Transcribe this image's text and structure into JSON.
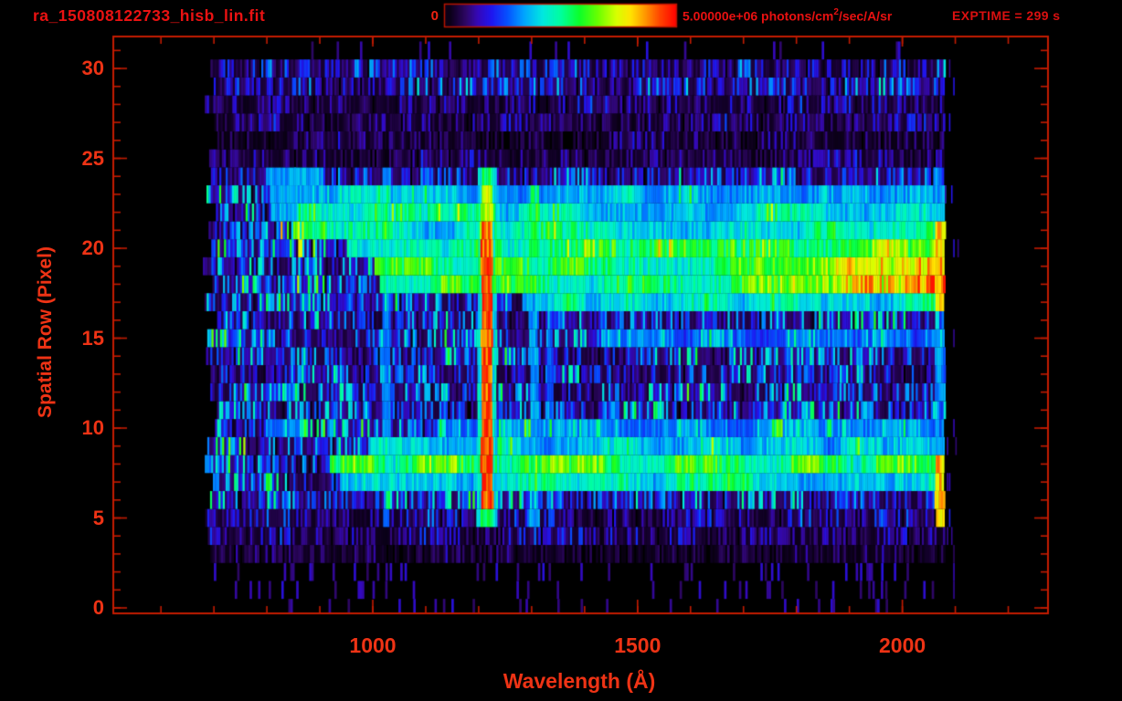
{
  "chart_data": {
    "type": "heatmap",
    "title": "ra_150808122733_hisb_lin.fit",
    "xlabel": "Wavelength (Å)",
    "ylabel": "Spatial Row (Pixel)",
    "exptime_label": "EXPTIME = 299 s",
    "exptime_s": 299,
    "xlim": [
      510,
      2275
    ],
    "ylim": [
      -0.3,
      32
    ],
    "x_ticks": [
      1000,
      1500,
      2000
    ],
    "x_minor_step": 100,
    "x_minor_range": [
      600,
      2200
    ],
    "y_ticks": [
      0,
      5,
      10,
      15,
      20,
      25,
      30
    ],
    "y_minor_step": 1,
    "grid": false,
    "legend": "colorbar-top",
    "colorbar": {
      "min": 0,
      "max": 5000000,
      "min_label": "0",
      "max_label_prefix": "5.00000e+06 photons/cm",
      "max_label_sup": "2",
      "max_label_suffix": "/sec/A/sr",
      "units": "photons/cm^2/sec/A/sr",
      "palette": "rainbow"
    },
    "data_extent": {
      "wavelength": [
        685,
        2078
      ],
      "rows": [
        0,
        31
      ]
    },
    "palette_stops": [
      [
        0.0,
        "#000000"
      ],
      [
        0.04,
        "#15002e"
      ],
      [
        0.09,
        "#2e0766"
      ],
      [
        0.14,
        "#3508b8"
      ],
      [
        0.2,
        "#1f16f0"
      ],
      [
        0.27,
        "#0553ff"
      ],
      [
        0.34,
        "#00a4ff"
      ],
      [
        0.42,
        "#00e8e0"
      ],
      [
        0.5,
        "#00ff9d"
      ],
      [
        0.58,
        "#0cff2a"
      ],
      [
        0.66,
        "#6aff00"
      ],
      [
        0.74,
        "#d8ff00"
      ],
      [
        0.8,
        "#ffe400"
      ],
      [
        0.87,
        "#ff9000"
      ],
      [
        0.93,
        "#ff4200"
      ],
      [
        1.0,
        "#ff0000"
      ]
    ],
    "rows": [
      {
        "r": 0,
        "bg": 0.015
      },
      {
        "r": 1,
        "bg": 0.02
      },
      {
        "r": 2,
        "bg": 0.025
      },
      {
        "r": 3,
        "bg": 0.06
      },
      {
        "r": 4,
        "bg": 0.1
      },
      {
        "r": 5,
        "bg": 0.13
      },
      {
        "r": 6,
        "bg": 0.21
      },
      {
        "r": 7,
        "bg": 0.22,
        "band": 0.4,
        "from": 935
      },
      {
        "r": 8,
        "bg": 0.22,
        "band": 0.52,
        "from": 915
      },
      {
        "r": 9,
        "bg": 0.24,
        "band": 0.36,
        "from": 990
      },
      {
        "r": 10,
        "bg": 0.26,
        "band": 0.3,
        "from": 1120
      },
      {
        "r": 11,
        "bg": 0.23
      },
      {
        "r": 12,
        "bg": 0.22
      },
      {
        "r": 13,
        "bg": 0.19
      },
      {
        "r": 14,
        "bg": 0.21
      },
      {
        "r": 15,
        "bg": 0.23,
        "band": 0.27,
        "from": 1430
      },
      {
        "r": 16,
        "bg": 0.2
      },
      {
        "r": 17,
        "bg": 0.24,
        "band": 0.42,
        "from": 1280
      },
      {
        "r": 18,
        "bg": 0.28,
        "band": 0.5,
        "from": 1010,
        "ramp": 0.42,
        "ramp_from": 1640
      },
      {
        "r": 19,
        "bg": 0.28,
        "band": 0.52,
        "from": 1000,
        "ramp": 0.36,
        "ramp_from": 1620
      },
      {
        "r": 20,
        "bg": 0.28,
        "band": 0.46,
        "from": 950,
        "ramp": 0.22,
        "ramp_from": 1700
      },
      {
        "r": 21,
        "bg": 0.28,
        "band": 0.43,
        "from": 890,
        "ramp": 0.1,
        "ramp_from": 1750
      },
      {
        "r": 22,
        "bg": 0.26,
        "band": 0.4,
        "from": 855
      },
      {
        "r": 23,
        "bg": 0.24,
        "band": 0.34,
        "from": 820
      },
      {
        "r": 24,
        "bg": 0.22
      },
      {
        "r": 25,
        "bg": 0.08
      },
      {
        "r": 26,
        "bg": 0.07
      },
      {
        "r": 27,
        "bg": 0.09
      },
      {
        "r": 28,
        "bg": 0.11
      },
      {
        "r": 29,
        "bg": 0.17
      },
      {
        "r": 30,
        "bg": 0.16
      },
      {
        "r": 31,
        "bg": 0.01
      }
    ],
    "emission_lines": [
      {
        "wl": 1025.7,
        "half_width": 7,
        "rows": [
          4.5,
          24.3
        ],
        "boost": 0.3,
        "extra_rows": [
          19,
          23.5
        ],
        "extra_boost": 0.48
      },
      {
        "wl": 1304,
        "half_width": 8,
        "rows": [
          4.5,
          23.5
        ],
        "boost": 0.34,
        "extra_rows": [
          19,
          23.5
        ],
        "extra_boost": 0.5
      },
      {
        "wl": 1335,
        "half_width": 5,
        "rows": [
          4.5,
          23.5
        ],
        "boost": 0.26
      }
    ],
    "lyman_alpha": {
      "wl": 1215.7,
      "core_half": 11,
      "halo_half": 19,
      "rows": [
        4.6,
        24.4
      ],
      "halo_boost": 0.42,
      "core_levels": [
        {
          "upto": 5.5,
          "v": 0.55
        },
        {
          "upto": 21.5,
          "v": 0.93
        },
        {
          "upto": 23.5,
          "v": 0.72
        },
        {
          "upto": 24.5,
          "v": 0.55
        }
      ]
    },
    "blobs": [
      {
        "wl": [
          805,
          905
        ],
        "rows": [
          21.8,
          24.2
        ],
        "boost": 0.34
      },
      {
        "wl": [
          858,
          912
        ],
        "rows": [
          20.3,
          21.9
        ],
        "boost": 0.48
      },
      {
        "wl": [
          795,
          862
        ],
        "rows": [
          9.6,
          10.9
        ],
        "boost": 0.3
      },
      {
        "wl": [
          800,
          852
        ],
        "rows": [
          11.2,
          12.6
        ],
        "boost": 0.24
      },
      {
        "wl": [
          2078,
          2088
        ],
        "rows": [
          28.6,
          30.6
        ],
        "boost": 0.85
      }
    ],
    "edge_column": {
      "wl": [
        2060,
        2078
      ],
      "rows": [
        4.5,
        24.5
      ],
      "weak": 0.3,
      "strong": 0.88,
      "strong_rows": [
        [
          4.5,
          8.5
        ],
        [
          16.5,
          21.5
        ]
      ]
    },
    "overflow_speckle": {
      "wl": [
        2080,
        2108
      ],
      "density": 0.1,
      "v": [
        0.08,
        0.24
      ]
    }
  },
  "colors": {
    "background": "#000000",
    "title_text": "#ea1212",
    "axis_text": "#ee3315",
    "frame": "#c41b00",
    "colorbar_border": "#b61400"
  }
}
